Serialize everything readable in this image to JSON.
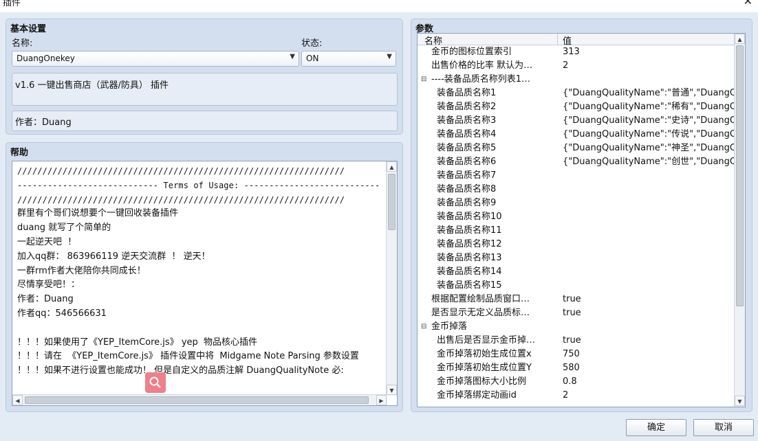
{
  "window": {
    "title": "插件",
    "close_glyph": "✕"
  },
  "basic": {
    "header": "基本设置",
    "name_label": "名称:",
    "name_value": "DuangOnekey",
    "status_label": "状态:",
    "status_value": "ON",
    "description": "v1.6 一键出售商店（武器/防具） 插件",
    "author": "作者：Duang"
  },
  "help": {
    "header": "帮助",
    "lines": [
      "/////////////////////////////////////////////////////////////////",
      "---------------------------- Terms of Usage: ---------------------------",
      "/////////////////////////////////////////////////////////////////",
      "群里有个哥们说想要个一键回收装备插件",
      "duang 就写了个简单的",
      "一起逆天吧  ！",
      "加入qq群： 863966119 逆天交流群  ！ 逆天！",
      "一群rm作者大佬陪你共同成长！",
      "尽情享受吧！：",
      "作者：Duang",
      "作者qq：546566631",
      "",
      "！！！如果使用了《YEP_ItemCore.js》 yep  物品核心插件",
      "！！！请在  《YEP_ItemCore.js》 插件设置中将  Midgame Note Parsing 参数设置",
      "！！！如果不进行设置也能成功！ 但是自定义的品质注解 DuangQualityNote 必:"
    ]
  },
  "params": {
    "header": "参数",
    "col_name": "名称",
    "col_value": "值",
    "rows": [
      {
        "name": "金币的图标位置索引",
        "value": "313",
        "indent": 1
      },
      {
        "name": "出售价格的比率 默认为…",
        "value": "2",
        "indent": 1
      },
      {
        "name": "----装备品质名称列表1…",
        "value": "",
        "indent": 1,
        "toggle": "⊟"
      },
      {
        "name": "装备品质名称1",
        "value": "{\"DuangQualityName\":\"普通\",\"DuangQ…",
        "indent": 2
      },
      {
        "name": "装备品质名称2",
        "value": "{\"DuangQualityName\":\"稀有\",\"DuangQ…",
        "indent": 2
      },
      {
        "name": "装备品质名称3",
        "value": "{\"DuangQualityName\":\"史诗\",\"DuangQ…",
        "indent": 2
      },
      {
        "name": "装备品质名称4",
        "value": "{\"DuangQualityName\":\"传说\",\"DuangQ…",
        "indent": 2
      },
      {
        "name": "装备品质名称5",
        "value": "{\"DuangQualityName\":\"神圣\",\"DuangQ…",
        "indent": 2
      },
      {
        "name": "装备品质名称6",
        "value": "{\"DuangQualityName\":\"创世\",\"DuangQ…",
        "indent": 2
      },
      {
        "name": "装备品质名称7",
        "value": "",
        "indent": 2
      },
      {
        "name": "装备品质名称8",
        "value": "",
        "indent": 2
      },
      {
        "name": "装备品质名称9",
        "value": "",
        "indent": 2
      },
      {
        "name": "装备品质名称10",
        "value": "",
        "indent": 2
      },
      {
        "name": "装备品质名称11",
        "value": "",
        "indent": 2
      },
      {
        "name": "装备品质名称12",
        "value": "",
        "indent": 2
      },
      {
        "name": "装备品质名称13",
        "value": "",
        "indent": 2
      },
      {
        "name": "装备品质名称14",
        "value": "",
        "indent": 2
      },
      {
        "name": "装备品质名称15",
        "value": "",
        "indent": 2
      },
      {
        "name": "根据配置绘制品质窗口…",
        "value": "true",
        "indent": 1
      },
      {
        "name": "是否显示无定义品质标…",
        "value": "true",
        "indent": 1
      },
      {
        "name": "金币掉落",
        "value": "",
        "indent": 1,
        "toggle": "⊟"
      },
      {
        "name": "出售后是否显示金币掉…",
        "value": "true",
        "indent": 2
      },
      {
        "name": "金币掉落初始生成位置x",
        "value": "750",
        "indent": 2
      },
      {
        "name": "金币掉落初始生成位置Y",
        "value": "580",
        "indent": 2
      },
      {
        "name": "金币掉落图标大小比例",
        "value": "0.8",
        "indent": 2
      },
      {
        "name": "金币掉落绑定动画id",
        "value": "2",
        "indent": 2
      }
    ]
  },
  "buttons": {
    "ok": "确定",
    "cancel": "取消"
  }
}
